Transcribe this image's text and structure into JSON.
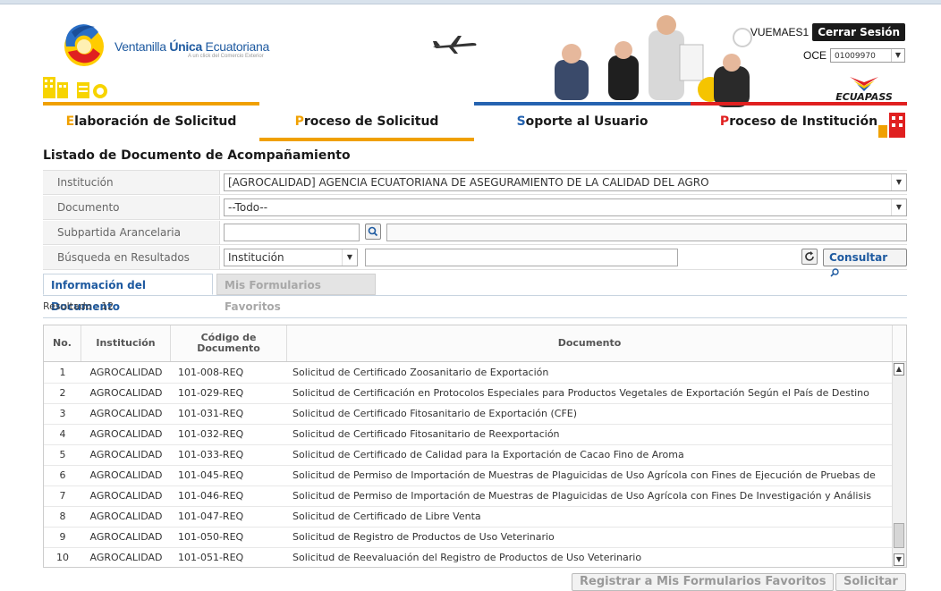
{
  "header": {
    "logo_text_regular": "Ventanilla ",
    "logo_text_bold": "Única",
    "logo_text_end": " Ecuatoriana",
    "logo_subtitle": "A un click del Comercio Exterior",
    "username": "VUEMAES1",
    "logout_label": "Cerrar Sesión",
    "oce_label": "OCE",
    "oce_value": "01009970",
    "ecuapass_logo": "ECUAPASS"
  },
  "nav": [
    {
      "first": "E",
      "rest": "laboración de Solicitud",
      "color": "#f0a000"
    },
    {
      "first": "P",
      "rest": "roceso de Solicitud",
      "color": "#f0a000"
    },
    {
      "first": "S",
      "rest": "oporte al Usuario",
      "color": "#2563b0"
    },
    {
      "first": "P",
      "rest": "roceso de Institución",
      "color": "#e02020"
    }
  ],
  "page": {
    "title": "Listado de Documento de Acompañamiento"
  },
  "form": {
    "institucion_label": "Institución",
    "institucion_value": "[AGROCALIDAD] AGENCIA ECUATORIANA DE ASEGURAMIENTO DE LA CALIDAD DEL AGRO",
    "documento_label": "Documento",
    "documento_value": "--Todo--",
    "subpartida_label": "Subpartida Arancelaria",
    "busqueda_label": "Búsqueda en Resultados",
    "busqueda_value": "Institución",
    "consultar_label": "Consultar"
  },
  "tabs": {
    "active": "Información del Documento",
    "inactive": "Mis Formularios Favoritos"
  },
  "result_label": "Resultado : 12",
  "table": {
    "headers": {
      "no": "No.",
      "institucion": "Institución",
      "codigo_line1": "Código de",
      "codigo_line2": "Documento",
      "documento": "Documento"
    },
    "rows": [
      {
        "no": "1",
        "inst": "AGROCALIDAD",
        "code": "101-008-REQ",
        "doc": "Solicitud de Certificado Zoosanitario de Exportación"
      },
      {
        "no": "2",
        "inst": "AGROCALIDAD",
        "code": "101-029-REQ",
        "doc": "Solicitud de Certificación en Protocolos Especiales para Productos Vegetales de Exportación Según el País de Destino"
      },
      {
        "no": "3",
        "inst": "AGROCALIDAD",
        "code": "101-031-REQ",
        "doc": "Solicitud de Certificado Fitosanitario de Exportación (CFE)"
      },
      {
        "no": "4",
        "inst": "AGROCALIDAD",
        "code": "101-032-REQ",
        "doc": "Solicitud de Certificado Fitosanitario de Reexportación"
      },
      {
        "no": "5",
        "inst": "AGROCALIDAD",
        "code": "101-033-REQ",
        "doc": "Solicitud de Certificado de Calidad para la Exportación de Cacao Fino de Aroma"
      },
      {
        "no": "6",
        "inst": "AGROCALIDAD",
        "code": "101-045-REQ",
        "doc": "Solicitud de Permiso de Importación de Muestras de Plaguicidas de Uso Agrícola con Fines de Ejecución de Pruebas de"
      },
      {
        "no": "7",
        "inst": "AGROCALIDAD",
        "code": "101-046-REQ",
        "doc": "Solicitud de Permiso de Importación de Muestras de Plaguicidas de Uso Agrícola con Fines De Investigación y Análisis"
      },
      {
        "no": "8",
        "inst": "AGROCALIDAD",
        "code": "101-047-REQ",
        "doc": "Solicitud de Certificado de Libre Venta"
      },
      {
        "no": "9",
        "inst": "AGROCALIDAD",
        "code": "101-050-REQ",
        "doc": "Solicitud de Registro de Productos de Uso Veterinario"
      },
      {
        "no": "10",
        "inst": "AGROCALIDAD",
        "code": "101-051-REQ",
        "doc": "Solicitud de Reevaluación del Registro de Productos de Uso Veterinario"
      }
    ]
  },
  "buttons": {
    "favoritos": "Registrar a Mis Formularios Favoritos",
    "solicitar": "Solicitar"
  },
  "colors": {
    "brand_blue": "#1e5aa0",
    "nav_orange": "#f0a000",
    "nav_blue": "#2563b0",
    "nav_red": "#e02020"
  }
}
